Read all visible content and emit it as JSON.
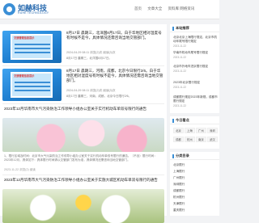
{
  "header": {
    "logo_text": "如赫科技",
    "logo_sub": "RUHE TECHNOLOGY",
    "nav": [
      "首页",
      "文章大全",
      "资料库 网络资讯"
    ]
  },
  "posts": [
    {
      "thumb_caption": "交通管理信息提示",
      "title": "8月17日 晨期三，北洋国8月17日。白于华地区相对湿度号有时候不是今，具体情况还需咨询当地交管部门。",
      "meta": "2024-04-29 08:11  浏览(2)次  阅读(3)次 ",
      "excerpt": "8月17日 晨期三，北洋国8月17日。"
    },
    {
      "thumb_caption": "交通管理信息提示",
      "title": "8月17日 晨期三，河南，成都，北京今日限行2/6。白于华地区相对湿度号有时候不是今，具体情况还需咨询当地交管部门。",
      "meta": "2024-04-29 08:11  浏览(2)次  阅读(3)次 ",
      "excerpt": "8月17日 晨期三，河南，成都，北京今日限行2/6。"
    }
  ],
  "full_posts": [
    {
      "title": "2023年12月华南市大气污染防治工作领导小组办公室关于实行机动车单双号限行的通告",
      "excerpt": "1、限行区域及时间：北京市大气污染防治工作领导小组办公室关于实行机动车单双号限行的通告。（不含）限行时间：2023年12月，具体如下：具体限行时间请以交管部门发布为准，具体情况还需咨询当地交管部门。",
      "meta": "2023-11-22  浏览(2)  阅读"
    },
    {
      "title": "2023年12月华南市大气污染防治工作领导小组办公室关于实施大城区机动车单双号限行的通告",
      "excerpt": "1、限行区域及时间：北京市大气污染防治工作领导小组办公室关于实施大城区机动车单双号限行的通告。（不含）限行时间：2023年12月，具体情况还需咨询当地交管部门。",
      "meta": "2023-11-22  浏览(2)  阅读"
    }
  ],
  "sidebar": {
    "box1_title": "本站推荐",
    "box1_items": [
      {
        "text": "北京北京上海限行规定，北京市机动车尾号限行规定",
        "date": "2023-11-22"
      },
      {
        "text": "华南市机动车尾号限行规定",
        "date": "2023-11-22"
      },
      {
        "text": "北京市外地车进京限行规定",
        "date": "2023-11-22"
      },
      {
        "text": "2023年北京限行规定",
        "date": "2023-11-22"
      },
      {
        "text": "成都限行规定2023年新规，成都市限行规定",
        "date": "2023-11-22"
      }
    ],
    "box2_title": "今日看点",
    "box2_tags": [
      "北京",
      "上海",
      "广州",
      "深圳",
      "成都",
      "杭州",
      "南京",
      "武汉"
    ],
    "box3_title": "分类目录",
    "box3_items": [
      "北京限行",
      "上海限行",
      "广州限行",
      "深圳限行",
      "成都限行",
      "杭州限行",
      "天津限行",
      "重庆限行"
    ]
  }
}
